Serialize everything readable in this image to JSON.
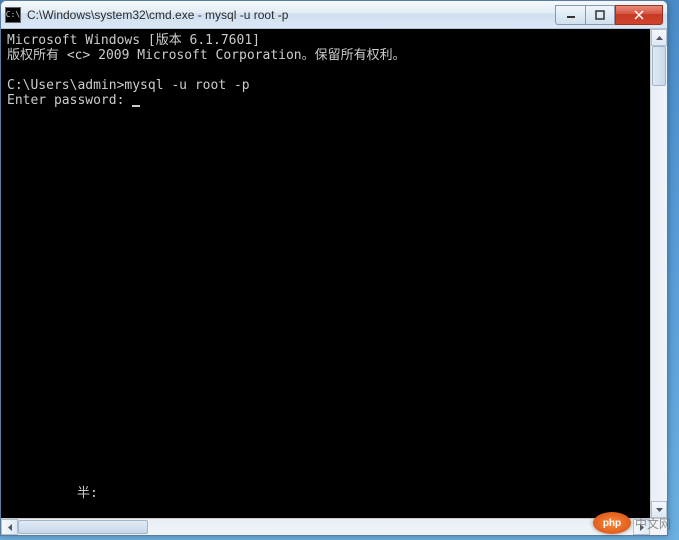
{
  "window": {
    "title": "C:\\Windows\\system32\\cmd.exe - mysql  -u root -p",
    "icon_label": "C:\\"
  },
  "terminal": {
    "line1": "Microsoft Windows [版本 6.1.7601]",
    "line2": "版权所有 <c> 2009 Microsoft Corporation。保留所有权利。",
    "line3": "",
    "line4": "C:\\Users\\admin>mysql -u root -p",
    "line5": "Enter password: "
  },
  "status": {
    "text": "半:"
  },
  "watermark": {
    "logo": "php",
    "text": "中文网"
  }
}
